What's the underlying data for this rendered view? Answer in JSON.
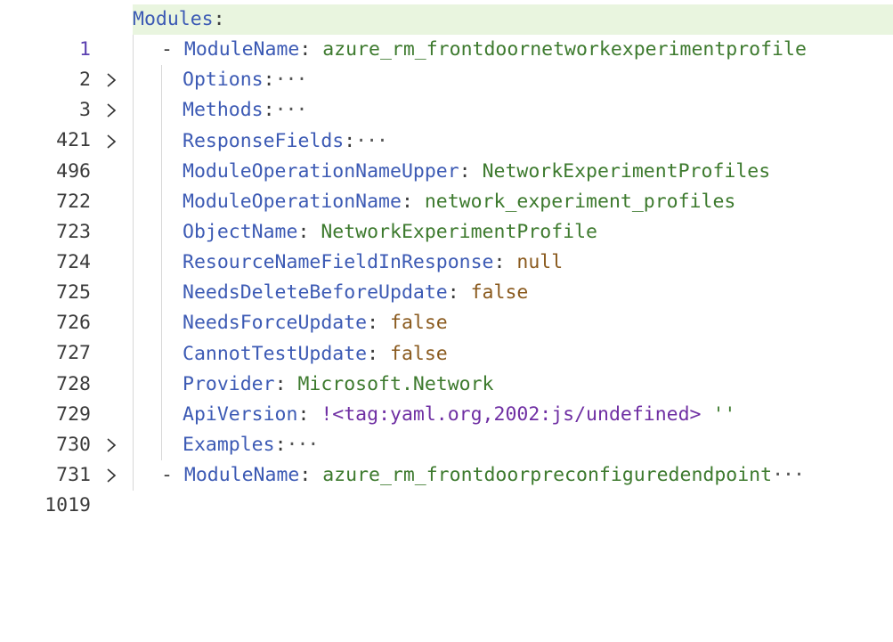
{
  "editor": {
    "language": "yaml",
    "colors": {
      "current_line_bg": "#e9f5df",
      "key": "#3c5ab4",
      "string": "#3d7a2e",
      "literal": "#8a5a1e",
      "tag": "#6f2fa3"
    },
    "lines": [
      {
        "num": "1",
        "key": "Modules",
        "sep": ":",
        "value": "",
        "folded": false,
        "current": true
      },
      {
        "num": "2",
        "dash": "- ",
        "key": "ModuleName",
        "sep": ": ",
        "value": "azure_rm_frontdoornetworkexperimentprofile",
        "folded": false
      },
      {
        "num": "3",
        "key": "Options",
        "sep": ":",
        "ellipsis": "···",
        "folded": true
      },
      {
        "num": "421",
        "key": "Methods",
        "sep": ":",
        "ellipsis": "···",
        "folded": true
      },
      {
        "num": "496",
        "key": "ResponseFields",
        "sep": ":",
        "ellipsis": "···",
        "folded": true
      },
      {
        "num": "722",
        "key": "ModuleOperationNameUpper",
        "sep": ": ",
        "value": "NetworkExperimentProfiles"
      },
      {
        "num": "723",
        "key": "ModuleOperationName",
        "sep": ": ",
        "value": "network_experiment_profiles"
      },
      {
        "num": "724",
        "key": "ObjectName",
        "sep": ": ",
        "value": "NetworkExperimentProfile"
      },
      {
        "num": "725",
        "key": "ResourceNameFieldInResponse",
        "sep": ": ",
        "value": "null"
      },
      {
        "num": "726",
        "key": "NeedsDeleteBeforeUpdate",
        "sep": ": ",
        "value": "false"
      },
      {
        "num": "727",
        "key": "NeedsForceUpdate",
        "sep": ": ",
        "value": "false"
      },
      {
        "num": "728",
        "key": "CannotTestUpdate",
        "sep": ": ",
        "value": "false"
      },
      {
        "num": "729",
        "key": "Provider",
        "sep": ": ",
        "value": "Microsoft.Network"
      },
      {
        "num": "730",
        "key": "ApiVersion",
        "sep": ": ",
        "value": "!<tag:yaml.org,2002:js/undefined>",
        "value2": " ''"
      },
      {
        "num": "731",
        "key": "Examples",
        "sep": ":",
        "ellipsis": "···",
        "folded": true
      },
      {
        "num": "1019",
        "dash": "- ",
        "key": "ModuleName",
        "sep": ": ",
        "value": "azure_rm_frontdoorpreconfiguredendpoint",
        "ellipsis": "···",
        "folded": true
      }
    ]
  }
}
